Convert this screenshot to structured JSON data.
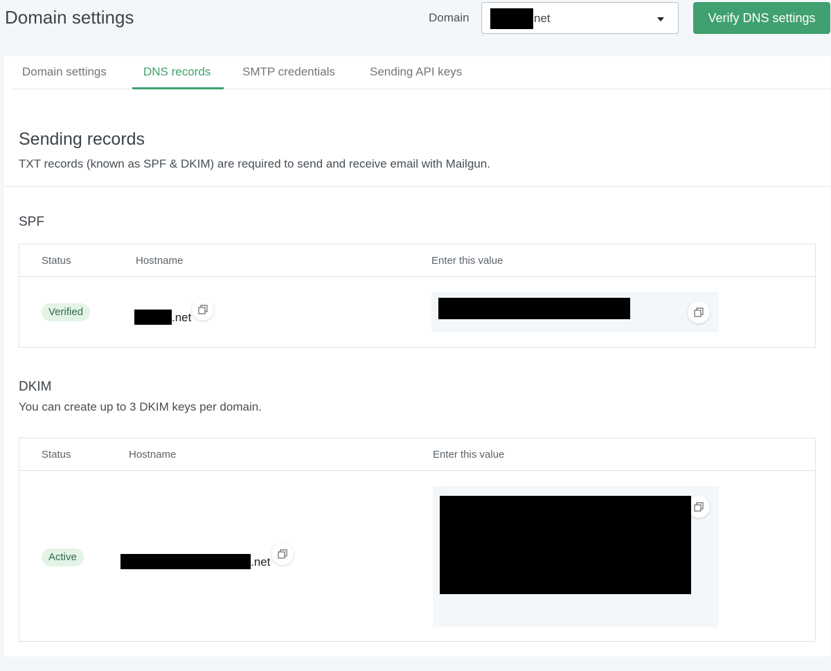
{
  "header": {
    "title": "Domain settings",
    "domain_label": "Domain",
    "domain_value": "net",
    "verify_button": "Verify DNS settings"
  },
  "tabs": [
    {
      "label": "Domain settings"
    },
    {
      "label": "DNS records"
    },
    {
      "label": "SMTP credentials"
    },
    {
      "label": "Sending API keys"
    }
  ],
  "sending": {
    "title": "Sending records",
    "description": "TXT records (known as SPF & DKIM) are required to send and receive email with Mailgun."
  },
  "spf": {
    "title": "SPF",
    "columns": [
      "Status",
      "Hostname",
      "Enter this value"
    ],
    "status": "Verified",
    "hostname_suffix": ".net"
  },
  "dkim": {
    "title": "DKIM",
    "description": "You can create up to 3 DKIM keys per domain.",
    "columns": [
      "Status",
      "Hostname",
      "Enter this value"
    ],
    "status": "Active",
    "hostname_suffix": ".net"
  },
  "colors": {
    "accent": "#40a06f",
    "badge_bg": "#e3f3e6",
    "page_bg": "#f4f7fa"
  },
  "icons": [
    "caret-down-icon",
    "copy-icon"
  ]
}
